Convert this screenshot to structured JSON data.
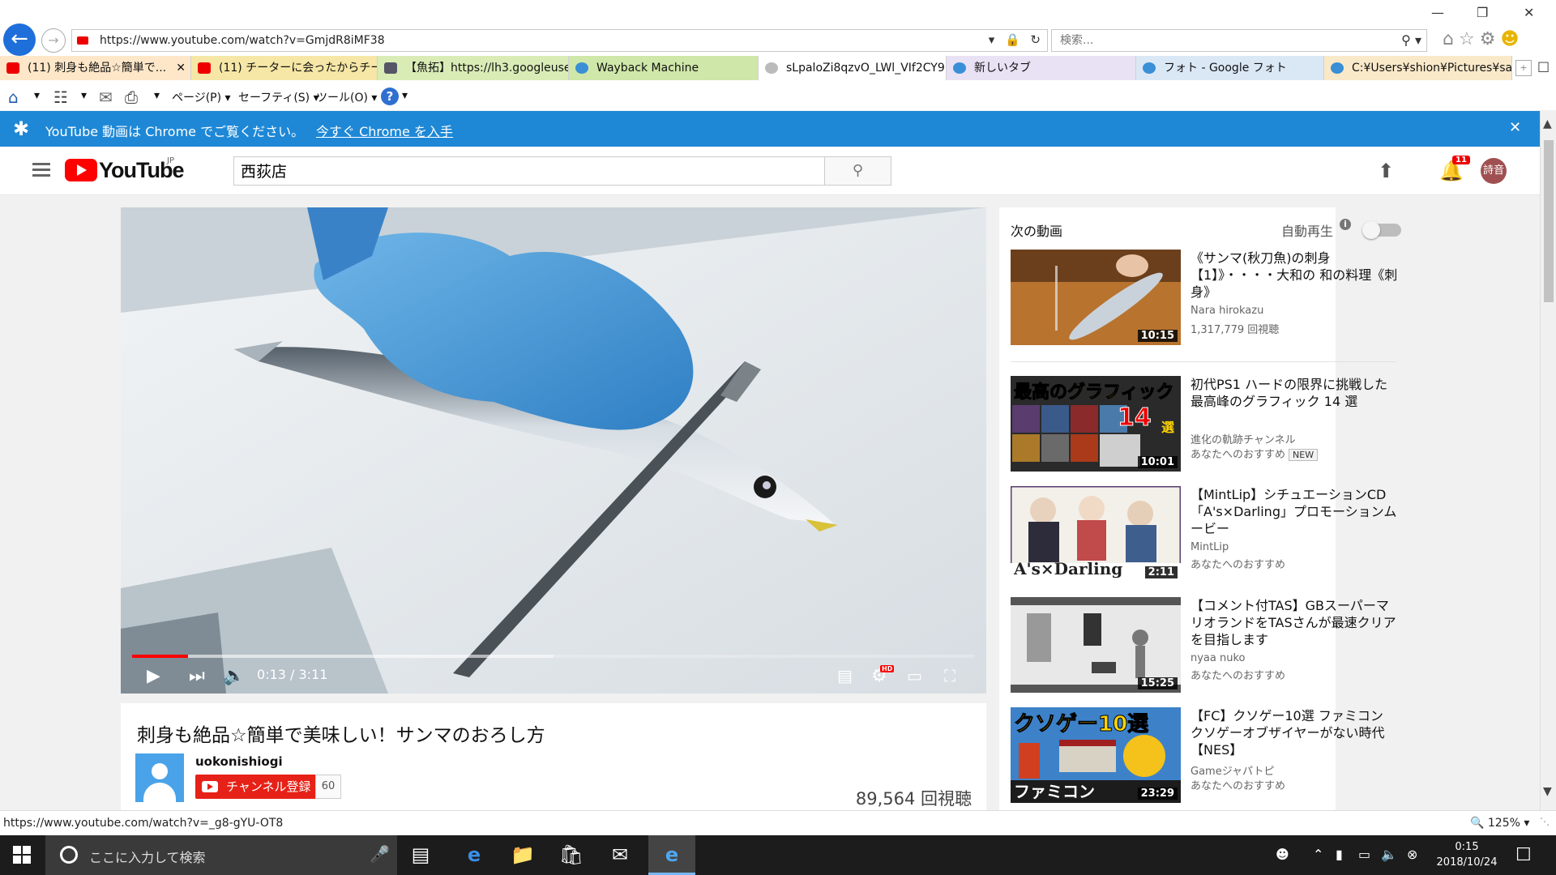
{
  "browser": {
    "url": "https://www.youtube.com/watch?v=GmjdR8iMF38",
    "search_placeholder": "検索...",
    "tabs": [
      {
        "label": "(11) 刺身も絶品☆簡単で...",
        "color": "#e00"
      },
      {
        "label": "(11) チーターに会ったからチート...",
        "color": "#e00"
      },
      {
        "label": "【魚拓】https://lh3.googleuse...",
        "color": "#556"
      },
      {
        "label": "Wayback Machine",
        "color": "#3a8fd6"
      },
      {
        "label": "sLpaloZi8qzvO_LWl_VIf2CY9...",
        "color": "#999"
      },
      {
        "label": "新しいタブ",
        "color": "#3a8fd6"
      },
      {
        "label": "フォト - Google フォト",
        "color": "#3a8fd6"
      },
      {
        "label": "C:¥Users¥shion¥Pictures¥san...",
        "color": "#3a8fd6"
      }
    ],
    "commands": {
      "page": "ページ(P)",
      "safety": "セーフティ(S)",
      "tools": "ツール(O)"
    },
    "status_url": "https://www.youtube.com/watch?v=_g8-gYU-OT8",
    "zoom": "125%"
  },
  "banner": {
    "text": "YouTube 動画は Chrome でご覧ください。",
    "link": "今すぐ Chrome を入手"
  },
  "youtube": {
    "logo_text": "YouTube",
    "region": "JP",
    "search_value": "西荻店",
    "notification_count": "11",
    "user_avatar": "詩音"
  },
  "player": {
    "time": "0:13 / 3:11",
    "progress_played_fraction": 0.066,
    "progress_buffered_fraction": 0.5
  },
  "video": {
    "title": "刺身も絶品☆簡単で美味しい！サンマのおろし方",
    "channel": "uokonishiogi",
    "subscribe_label": "チャンネル登録",
    "subscriber_count": "60",
    "views": "89,564 回視聴"
  },
  "sidebar": {
    "next_label": "次の動画",
    "autoplay_label": "自動再生",
    "items": [
      {
        "title": "《サンマ(秋刀魚)の刺身【1】》・・・・大和の 和の料理《刺身》",
        "channel": "Nara hirokazu",
        "meta": "1,317,779 回視聴",
        "duration": "10:15",
        "badge": ""
      },
      {
        "title": "初代PS1 ハードの限界に挑戦した最高峰のグラフィック 14 選",
        "channel": "進化の軌跡チャンネル",
        "meta": "あなたへのおすすめ",
        "duration": "10:01",
        "badge": "NEW"
      },
      {
        "title": "【MintLip】シチュエーションCD「A's×Darling」プロモーションムービー",
        "channel": "MintLip",
        "meta": "あなたへのおすすめ",
        "duration": "2:11",
        "badge": ""
      },
      {
        "title": "【コメント付TAS】GBスーパーマリオランドをTASさんが最速クリアを目指します",
        "channel": "nyaa nuko",
        "meta": "あなたへのおすすめ",
        "duration": "15:25",
        "badge": ""
      },
      {
        "title": "【FC】クソゲー10選 ファミコン クソゲーオブザイヤーがない時代【NES】",
        "channel": "Gameジャパトピ",
        "meta": "あなたへのおすすめ",
        "duration": "23:29",
        "badge": ""
      }
    ],
    "thumb_texts": {
      "t2_top": "最高のグラフィック",
      "t2_num": "14",
      "t2_sel": "選",
      "t3": "A's×Darling",
      "t5_top": "クソゲー10選",
      "t5_bot": "ファミコン"
    }
  },
  "taskbar": {
    "search_text": "ここに入力して検索",
    "time": "0:15",
    "date": "2018/10/24"
  }
}
